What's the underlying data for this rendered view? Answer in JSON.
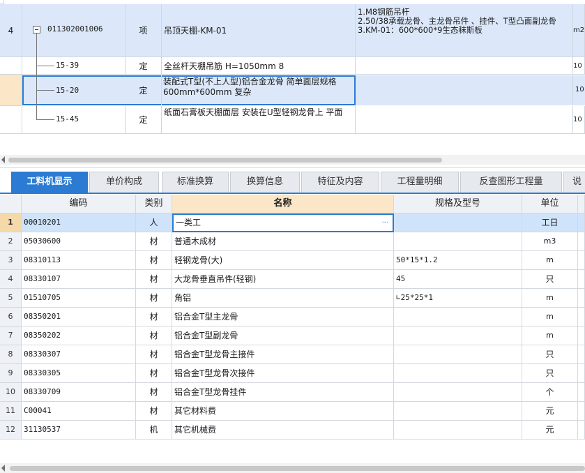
{
  "top_rows": [
    {
      "num": "4",
      "code": "011302001006",
      "type": "项",
      "name": "吊顶天棚-KM-01",
      "desc": [
        "1.M8钢筋吊杆",
        "2.50/38承载龙骨、主龙骨吊件 、挂件、T型凸面副龙骨",
        "3.KM-01：600*600*9生态秣斯板"
      ],
      "unit": "m2"
    },
    {
      "num": "",
      "code": "15-39",
      "type": "定",
      "name": "全丝杆天棚吊筋 H=1050mm 8",
      "desc": [],
      "unit": "10"
    },
    {
      "num": "",
      "code": "15-20",
      "type": "定",
      "name": "装配式T型(不上人型)铝合金龙骨 简单面层规格600mm*600mm 复杂",
      "desc": [],
      "unit": "10"
    },
    {
      "num": "",
      "code": "15-45",
      "type": "定",
      "name": "纸面石膏板天棚面层 安装在U型轻钢龙骨上 平面",
      "desc": [],
      "unit": "10"
    }
  ],
  "tabs": [
    "工料机显示",
    "单价构成",
    "标准换算",
    "换算信息",
    "特征及内容",
    "工程量明细",
    "反查图形工程量",
    "说"
  ],
  "grid": {
    "headers": {
      "code": "编码",
      "cat": "类别",
      "name": "名称",
      "spec": "规格及型号",
      "unit": "单位"
    },
    "rows": [
      {
        "n": "1",
        "code": "00010201",
        "cat": "人",
        "name": "一类工",
        "spec": "",
        "unit": "工日",
        "ellipsis": "···"
      },
      {
        "n": "2",
        "code": "05030600",
        "cat": "材",
        "name": "普通木成材",
        "spec": "",
        "unit": "m3"
      },
      {
        "n": "3",
        "code": "08310113",
        "cat": "材",
        "name": "轻钢龙骨(大)",
        "spec": "50*15*1.2",
        "unit": "m"
      },
      {
        "n": "4",
        "code": "08330107",
        "cat": "材",
        "name": "大龙骨垂直吊件(轻钢)",
        "spec": "45",
        "unit": "只"
      },
      {
        "n": "5",
        "code": "01510705",
        "cat": "材",
        "name": "角铝",
        "spec": "∟25*25*1",
        "unit": "m"
      },
      {
        "n": "6",
        "code": "08350201",
        "cat": "材",
        "name": "铝合金T型主龙骨",
        "spec": "",
        "unit": "m"
      },
      {
        "n": "7",
        "code": "08350202",
        "cat": "材",
        "name": "铝合金T型副龙骨",
        "spec": "",
        "unit": "m"
      },
      {
        "n": "8",
        "code": "08330307",
        "cat": "材",
        "name": "铝合金T型龙骨主接件",
        "spec": "",
        "unit": "只"
      },
      {
        "n": "9",
        "code": "08330305",
        "cat": "材",
        "name": "铝合金T型龙骨次接件",
        "spec": "",
        "unit": "只"
      },
      {
        "n": "10",
        "code": "08330709",
        "cat": "材",
        "name": "铝合金T型龙骨挂件",
        "spec": "",
        "unit": "个"
      },
      {
        "n": "11",
        "code": "C00041",
        "cat": "材",
        "name": "其它材料费",
        "spec": "",
        "unit": "元"
      },
      {
        "n": "12",
        "code": "31130537",
        "cat": "机",
        "name": "其它机械费",
        "spec": "",
        "unit": "元"
      }
    ]
  }
}
